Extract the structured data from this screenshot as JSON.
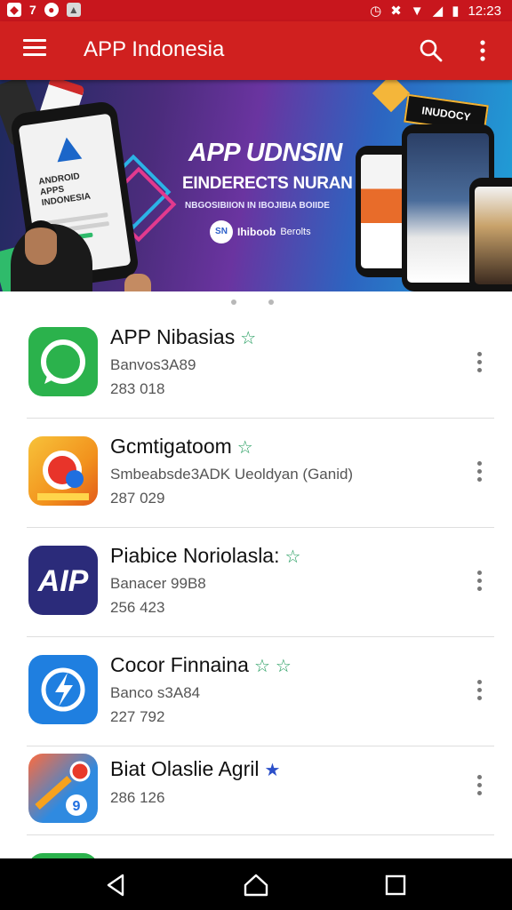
{
  "status_bar": {
    "time": "12:23",
    "left_icons": [
      "notification-icon",
      "notification-7-icon",
      "circle-app-icon",
      "image-icon"
    ],
    "right_icons": [
      "alarm-icon",
      "mute-icon",
      "wifi-icon",
      "signal-icon",
      "battery-icon"
    ]
  },
  "app_bar": {
    "title": "APP Indonesia",
    "color": "#d0201f"
  },
  "banner": {
    "headline": "APP UDNSIN",
    "subheadline": "EINDERECTS NURAN",
    "tagline": "NBGOSIBIION IN IBOJIBIA BOIIDE",
    "brand": "Ihiboob",
    "brand_suffix": "Berolts",
    "badge": "INUDOCY",
    "phone_text_lines": [
      "ANDROID",
      "APPS",
      "INDONESIA"
    ],
    "active_page": 1,
    "page_count": 2
  },
  "apps": [
    {
      "name": "APP Nibasias",
      "line2": "Banvos3A89",
      "line3": "283 018",
      "stars": 1,
      "icon": "whatsapp-style-icon",
      "icon_color": "#2bb24c"
    },
    {
      "name": "Gcmtigatoom",
      "line2": "Smbeabsde3ADK Ueoldyan (Ganid)",
      "line3": "287 029",
      "stars": 1,
      "icon": "camera-app-icon",
      "icon_color": "#f2921d"
    },
    {
      "name": "Piabice Noriolasla:",
      "line2": "Banacer 99B8",
      "line3": "256 423",
      "stars": 1,
      "icon": "aip-app-icon",
      "icon_color": "#2b2b7a"
    },
    {
      "name": "Cocor Finnaina",
      "line2": "Banco s3A84",
      "line3": "227 792",
      "stars": 2,
      "icon": "lightning-app-icon",
      "icon_color": "#1f7fe0"
    },
    {
      "name": "Biat Olaslie Agril",
      "line2": "286 126",
      "line3": "",
      "stars": 1,
      "icon": "maps-app-icon",
      "icon_color": "#2f8ae0"
    }
  ],
  "nav_bar": {
    "buttons": [
      "back-icon",
      "home-icon",
      "recents-icon"
    ]
  }
}
